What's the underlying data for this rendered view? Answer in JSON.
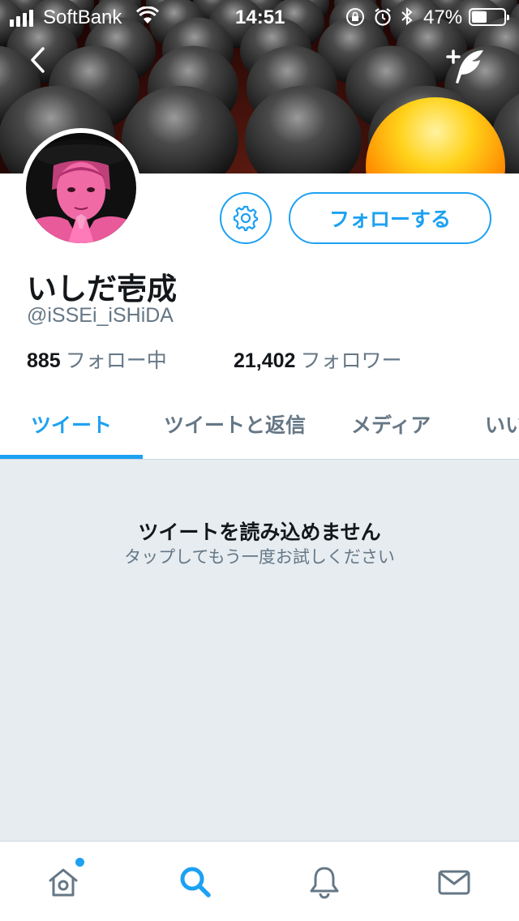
{
  "status_bar": {
    "carrier": "SoftBank",
    "time": "14:51",
    "battery_percent": "47%",
    "battery_level": 0.47,
    "icons": [
      "signal-icon",
      "wifi-icon",
      "orientation-lock-icon",
      "alarm-icon",
      "bluetooth-icon",
      "battery-icon"
    ]
  },
  "header": {
    "back_icon": "chevron-left-icon",
    "compose_icon": "compose-tweet-icon"
  },
  "profile": {
    "name": "いしだ壱成",
    "handle": "@iSSEi_iSHiDA",
    "following_count": "885",
    "following_label": "フォロー中",
    "followers_count": "21,402",
    "followers_label": "フォロワー",
    "settings_icon": "gear-icon",
    "follow_button_label": "フォローする"
  },
  "tabs": [
    {
      "label": "ツイート",
      "active": true
    },
    {
      "label": "ツイートと返信",
      "active": false
    },
    {
      "label": "メディア",
      "active": false
    },
    {
      "label": "いいね",
      "active": false
    }
  ],
  "content": {
    "error_title": "ツイートを読み込めません",
    "error_subtitle": "タップしてもう一度お試しください"
  },
  "bottom_nav": [
    {
      "icon": "home-icon",
      "active": false,
      "has_badge": true
    },
    {
      "icon": "search-icon",
      "active": true,
      "has_badge": false
    },
    {
      "icon": "bell-icon",
      "active": false,
      "has_badge": false
    },
    {
      "icon": "mail-icon",
      "active": false,
      "has_badge": false
    }
  ],
  "colors": {
    "accent": "#1da1f2",
    "text_primary": "#14171a",
    "text_secondary": "#657786",
    "content_background": "#e6ecf0",
    "divider": "#ccd6dd"
  }
}
